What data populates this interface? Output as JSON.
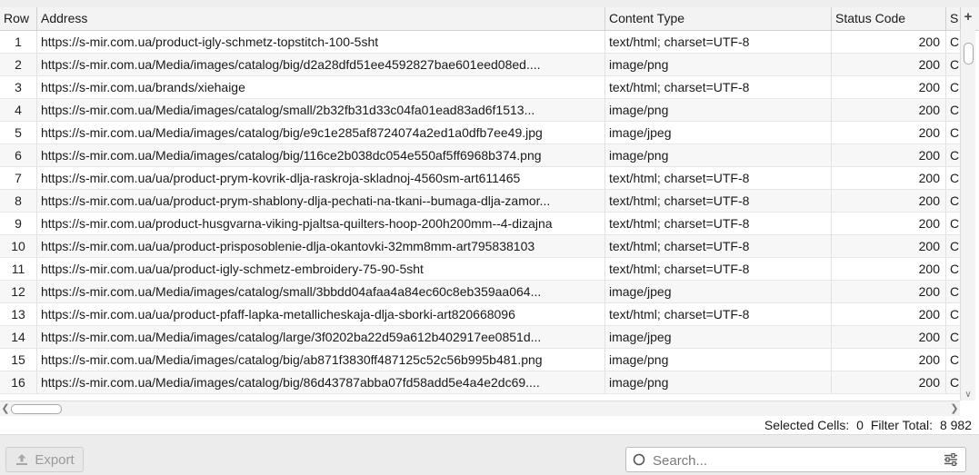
{
  "table": {
    "columns": [
      "Row",
      "Address",
      "Content Type",
      "Status Code",
      "S"
    ],
    "rows": [
      {
        "row": "1",
        "address": "https://s-mir.com.ua/product-igly-schmetz-topstitch-100-5sht",
        "content_type": "text/html; charset=UTF-8",
        "status_code": "200",
        "s": "C"
      },
      {
        "row": "2",
        "address": "https://s-mir.com.ua/Media/images/catalog/big/d2a28dfd51ee4592827bae601eed08ed....",
        "content_type": "image/png",
        "status_code": "200",
        "s": "C"
      },
      {
        "row": "3",
        "address": "https://s-mir.com.ua/brands/xiehaige",
        "content_type": "text/html; charset=UTF-8",
        "status_code": "200",
        "s": "C"
      },
      {
        "row": "4",
        "address": "https://s-mir.com.ua/Media/images/catalog/small/2b32fb31d33c04fa01ead83ad6f1513...",
        "content_type": "image/png",
        "status_code": "200",
        "s": "C"
      },
      {
        "row": "5",
        "address": "https://s-mir.com.ua/Media/images/catalog/big/e9c1e285af8724074a2ed1a0dfb7ee49.jpg",
        "content_type": "image/jpeg",
        "status_code": "200",
        "s": "C"
      },
      {
        "row": "6",
        "address": "https://s-mir.com.ua/Media/images/catalog/big/116ce2b038dc054e550af5ff6968b374.png",
        "content_type": "image/png",
        "status_code": "200",
        "s": "C"
      },
      {
        "row": "7",
        "address": "https://s-mir.com.ua/ua/product-prym-kovrik-dlja-raskroja-skladnoj-4560sm-art611465",
        "content_type": "text/html; charset=UTF-8",
        "status_code": "200",
        "s": "C"
      },
      {
        "row": "8",
        "address": "https://s-mir.com.ua/ua/product-prym-shablony-dlja-pechati-na-tkani--bumaga-dlja-zamor...",
        "content_type": "text/html; charset=UTF-8",
        "status_code": "200",
        "s": "C"
      },
      {
        "row": "9",
        "address": "https://s-mir.com.ua/product-husgvarna-viking-pjaltsa-quilters-hoop-200h200mm--4-dizajna",
        "content_type": "text/html; charset=UTF-8",
        "status_code": "200",
        "s": "C"
      },
      {
        "row": "10",
        "address": "https://s-mir.com.ua/ua/product-prisposoblenie-dlja-okantovki-32mm8mm-art795838103",
        "content_type": "text/html; charset=UTF-8",
        "status_code": "200",
        "s": "C"
      },
      {
        "row": "11",
        "address": "https://s-mir.com.ua/ua/product-igly-schmetz-embroidery-75-90-5sht",
        "content_type": "text/html; charset=UTF-8",
        "status_code": "200",
        "s": "C"
      },
      {
        "row": "12",
        "address": "https://s-mir.com.ua/Media/images/catalog/small/3bbdd04afaa4a84ec60c8eb359aa064...",
        "content_type": "image/jpeg",
        "status_code": "200",
        "s": "C"
      },
      {
        "row": "13",
        "address": "https://s-mir.com.ua/ua/product-pfaff-lapka-metallicheskaja-dlja-sborki-art820668096",
        "content_type": "text/html; charset=UTF-8",
        "status_code": "200",
        "s": "C"
      },
      {
        "row": "14",
        "address": "https://s-mir.com.ua/Media/images/catalog/large/3f0202ba22d59a612b402917ee0851d...",
        "content_type": "image/jpeg",
        "status_code": "200",
        "s": "C"
      },
      {
        "row": "15",
        "address": "https://s-mir.com.ua/Media/images/catalog/big/ab871f3830ff487125c52c56b995b481.png",
        "content_type": "image/png",
        "status_code": "200",
        "s": "C"
      },
      {
        "row": "16",
        "address": "https://s-mir.com.ua/Media/images/catalog/big/86d43787abba07fd58add5e4a4e2dc69....",
        "content_type": "image/png",
        "status_code": "200",
        "s": "C"
      }
    ],
    "add_column_symbol": "+"
  },
  "status": {
    "selected_label": "Selected Cells:",
    "selected_value": "0",
    "filter_label": "Filter Total:",
    "filter_value": "8 982"
  },
  "toolbar": {
    "export_label": "Export",
    "search_placeholder": "Search..."
  },
  "icons": {
    "export": "export-upload-icon",
    "search": "search-icon",
    "filter": "filter-sliders-icon",
    "add_column": "plus-icon"
  },
  "colors": {
    "header_bg": "#f3f3f3",
    "zebra": "#f7f7f7",
    "bottom_bar": "#ececec"
  }
}
